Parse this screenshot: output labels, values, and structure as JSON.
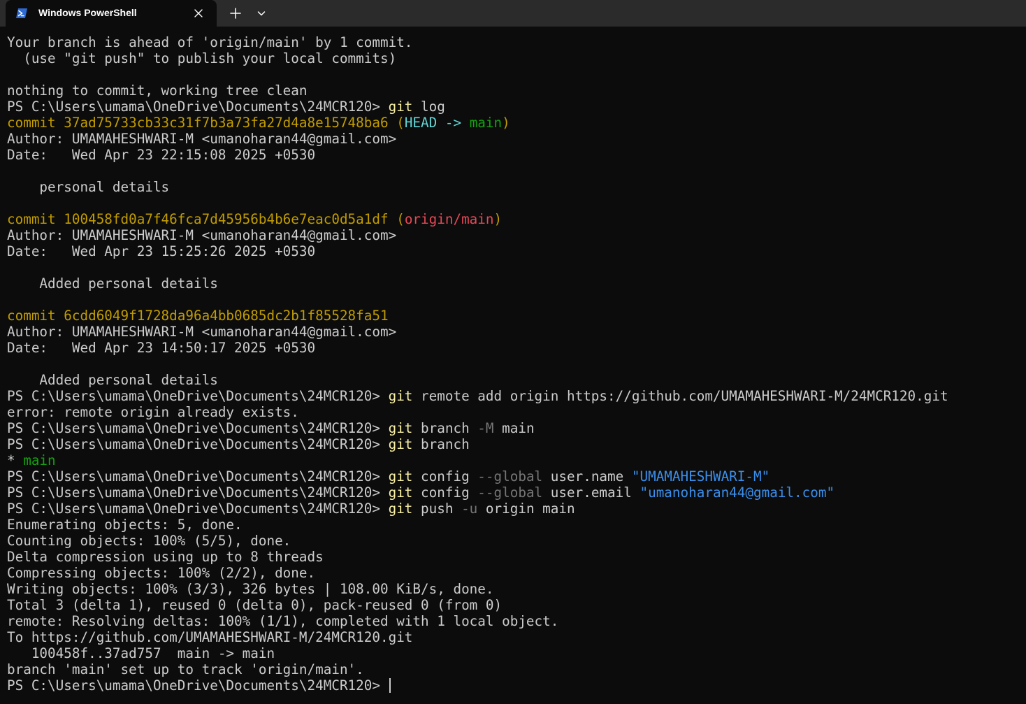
{
  "tab": {
    "title": "Windows PowerShell",
    "icon": "powershell-icon",
    "close_icon": "close-icon",
    "new_tab_icon": "plus-icon",
    "dropdown_icon": "chevron-down-icon"
  },
  "colors": {
    "background": "#0c0c0c",
    "foreground": "#cccccc",
    "commit_hash": "#c19c00",
    "head_ref": "#61d6d6",
    "branch_local": "#13a10e",
    "branch_remote": "#e74856",
    "command": "#f9f1a5",
    "parameter": "#767676",
    "string": "#3b8eea"
  },
  "terminal": {
    "prompt": "PS C:\\Users\\umama\\OneDrive\\Documents\\24MCR120> ",
    "lines": [
      [
        {
          "t": "Your branch is ahead of 'origin/main' by 1 commit."
        }
      ],
      [
        {
          "t": "  (use \"git push\" to publish your local commits)"
        }
      ],
      [],
      [
        {
          "t": "nothing to commit, working tree clean"
        }
      ],
      [
        {
          "t": "PS C:\\Users\\umama\\OneDrive\\Documents\\24MCR120> "
        },
        {
          "t": "git",
          "c": "bright-yellow"
        },
        {
          "t": " log"
        }
      ],
      [
        {
          "t": "commit 37ad75733cb33c31f7b3a73fa27d4a8e15748ba6 ",
          "c": "yellow"
        },
        {
          "t": "(",
          "c": "yellow"
        },
        {
          "t": "HEAD -> ",
          "c": "cyan"
        },
        {
          "t": "main",
          "c": "green"
        },
        {
          "t": ")",
          "c": "yellow"
        }
      ],
      [
        {
          "t": "Author: UMAMAHESHWARI-M <umanoharan44@gmail.com>"
        }
      ],
      [
        {
          "t": "Date:   Wed Apr 23 22:15:08 2025 +0530"
        }
      ],
      [],
      [
        {
          "t": "    personal details"
        }
      ],
      [],
      [
        {
          "t": "commit 100458fd0a7f46fca7d45956b4b6e7eac0d5a1df ",
          "c": "yellow"
        },
        {
          "t": "(",
          "c": "yellow"
        },
        {
          "t": "origin/main",
          "c": "red"
        },
        {
          "t": ")",
          "c": "yellow"
        }
      ],
      [
        {
          "t": "Author: UMAMAHESHWARI-M <umanoharan44@gmail.com>"
        }
      ],
      [
        {
          "t": "Date:   Wed Apr 23 15:25:26 2025 +0530"
        }
      ],
      [],
      [
        {
          "t": "    Added personal details"
        }
      ],
      [],
      [
        {
          "t": "commit 6cdd6049f1728da96a4bb0685dc2b1f85528fa51",
          "c": "yellow"
        }
      ],
      [
        {
          "t": "Author: UMAMAHESHWARI-M <umanoharan44@gmail.com>"
        }
      ],
      [
        {
          "t": "Date:   Wed Apr 23 14:50:17 2025 +0530"
        }
      ],
      [],
      [
        {
          "t": "    Added personal details"
        }
      ],
      [
        {
          "t": "PS C:\\Users\\umama\\OneDrive\\Documents\\24MCR120> "
        },
        {
          "t": "git",
          "c": "bright-yellow"
        },
        {
          "t": " remote add origin https://github.com/UMAMAHESHWARI-M/24MCR120.git"
        }
      ],
      [
        {
          "t": "error: remote origin already exists."
        }
      ],
      [
        {
          "t": "PS C:\\Users\\umama\\OneDrive\\Documents\\24MCR120> "
        },
        {
          "t": "git",
          "c": "bright-yellow"
        },
        {
          "t": " branch "
        },
        {
          "t": "-M",
          "c": "gray"
        },
        {
          "t": " main"
        }
      ],
      [
        {
          "t": "PS C:\\Users\\umama\\OneDrive\\Documents\\24MCR120> "
        },
        {
          "t": "git",
          "c": "bright-yellow"
        },
        {
          "t": " branch"
        }
      ],
      [
        {
          "t": "* "
        },
        {
          "t": "main",
          "c": "green"
        }
      ],
      [
        {
          "t": "PS C:\\Users\\umama\\OneDrive\\Documents\\24MCR120> "
        },
        {
          "t": "git",
          "c": "bright-yellow"
        },
        {
          "t": " config "
        },
        {
          "t": "--global",
          "c": "gray"
        },
        {
          "t": " user.name "
        },
        {
          "t": "\"UMAMAHESHWARI-M\"",
          "c": "blue"
        }
      ],
      [
        {
          "t": "PS C:\\Users\\umama\\OneDrive\\Documents\\24MCR120> "
        },
        {
          "t": "git",
          "c": "bright-yellow"
        },
        {
          "t": " config "
        },
        {
          "t": "--global",
          "c": "gray"
        },
        {
          "t": " user.email "
        },
        {
          "t": "\"umanoharan44@gmail.com\"",
          "c": "blue"
        }
      ],
      [
        {
          "t": "PS C:\\Users\\umama\\OneDrive\\Documents\\24MCR120> "
        },
        {
          "t": "git",
          "c": "bright-yellow"
        },
        {
          "t": " push "
        },
        {
          "t": "-u",
          "c": "gray"
        },
        {
          "t": " origin main"
        }
      ],
      [
        {
          "t": "Enumerating objects: 5, done."
        }
      ],
      [
        {
          "t": "Counting objects: 100% (5/5), done."
        }
      ],
      [
        {
          "t": "Delta compression using up to 8 threads"
        }
      ],
      [
        {
          "t": "Compressing objects: 100% (2/2), done."
        }
      ],
      [
        {
          "t": "Writing objects: 100% (3/3), 326 bytes | 108.00 KiB/s, done."
        }
      ],
      [
        {
          "t": "Total 3 (delta 1), reused 0 (delta 0), pack-reused 0 (from 0)"
        }
      ],
      [
        {
          "t": "remote: Resolving deltas: 100% (1/1), completed with 1 local object."
        }
      ],
      [
        {
          "t": "To https://github.com/UMAMAHESHWARI-M/24MCR120.git"
        }
      ],
      [
        {
          "t": "   100458f..37ad757  main -> main"
        }
      ],
      [
        {
          "t": "branch 'main' set up to track 'origin/main'."
        }
      ],
      [
        {
          "t": "PS C:\\Users\\umama\\OneDrive\\Documents\\24MCR120> "
        }
      ]
    ]
  }
}
